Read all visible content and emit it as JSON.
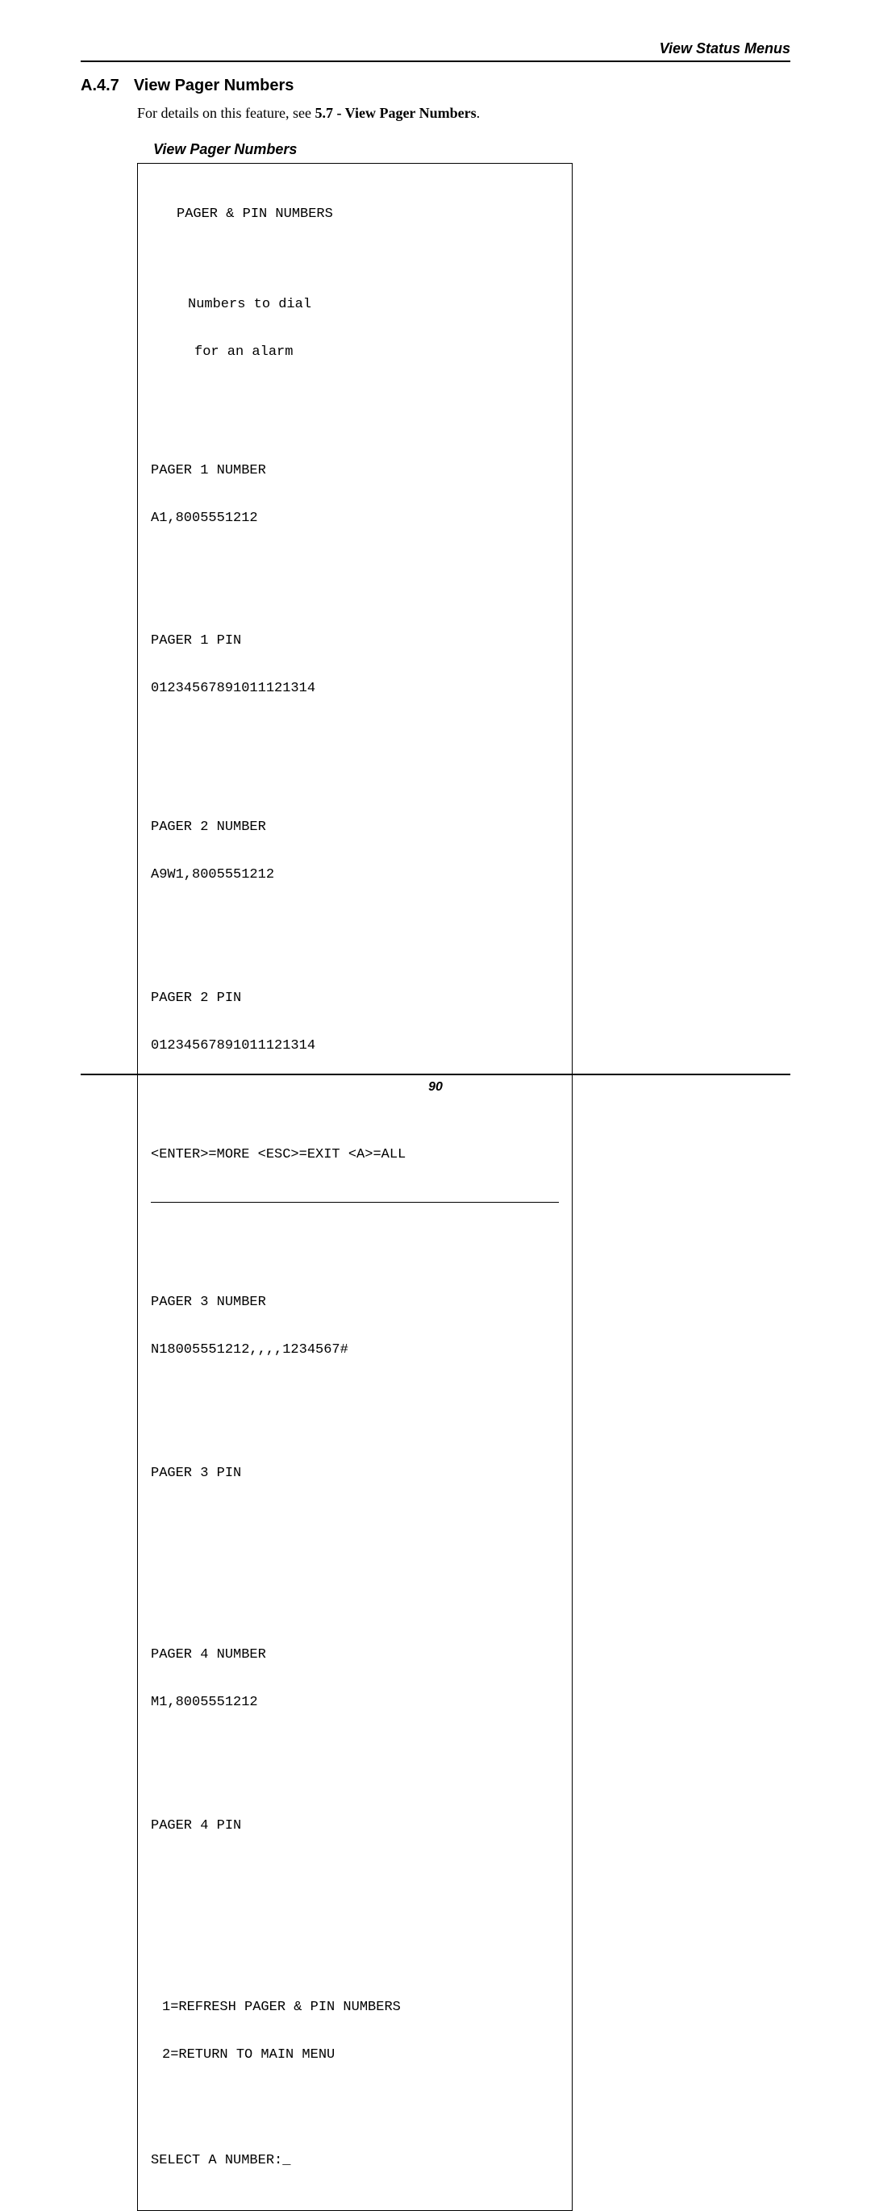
{
  "header": {
    "right_label": "View Status Menus"
  },
  "section": {
    "number": "A.4.7",
    "title": "View Pager Numbers",
    "intro_prefix": "For details on this feature, see ",
    "intro_bold": "5.7 - View Pager Numbers",
    "intro_suffix": "."
  },
  "figure": {
    "caption": "View Pager Numbers",
    "title_line": "PAGER & PIN NUMBERS",
    "subtitle_line1": "Numbers to dial",
    "subtitle_line2": "for an alarm",
    "pagers": [
      {
        "number_label": "PAGER 1 NUMBER",
        "number_value": "A1,8005551212",
        "pin_label": "PAGER 1 PIN",
        "pin_value": "01234567891011121314"
      },
      {
        "number_label": "PAGER 2 NUMBER",
        "number_value": "A9W1,8005551212",
        "pin_label": "PAGER 2 PIN",
        "pin_value": "01234567891011121314"
      }
    ],
    "nav_line": "<ENTER>=MORE <ESC>=EXIT <A>=ALL",
    "pagers2": [
      {
        "number_label": "PAGER 3 NUMBER",
        "number_value": "N18005551212,,,,1234567#",
        "pin_label": "PAGER 3 PIN",
        "pin_value": ""
      },
      {
        "number_label": "PAGER 4 NUMBER",
        "number_value": "M1,8005551212",
        "pin_label": "PAGER 4 PIN",
        "pin_value": ""
      }
    ],
    "menu_option1": "1=REFRESH PAGER & PIN NUMBERS",
    "menu_option2": "2=RETURN TO MAIN MENU",
    "select_prompt": "SELECT A NUMBER:_"
  },
  "footer": {
    "page_number": "90"
  }
}
